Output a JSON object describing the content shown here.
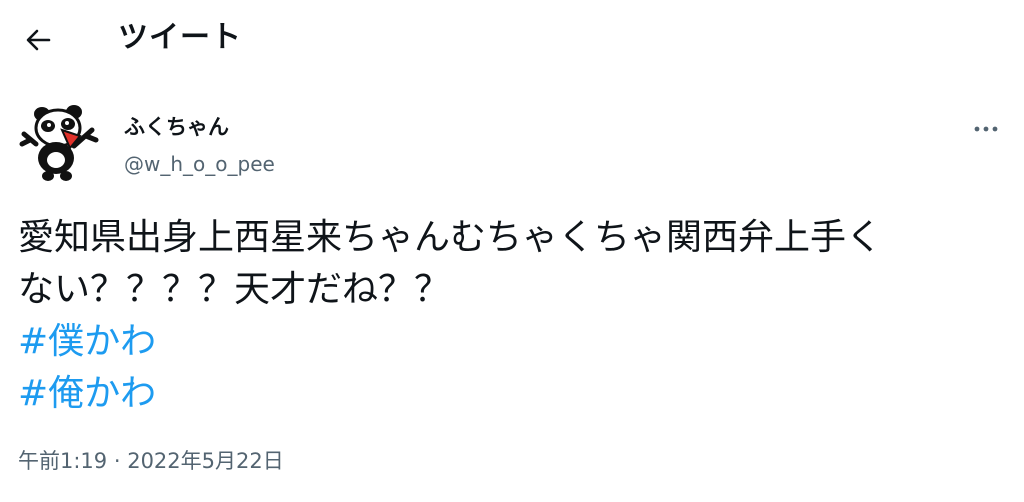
{
  "header": {
    "title": "ツイート",
    "back_icon": "arrow-left-icon"
  },
  "author": {
    "display_name": "ふくちゃん",
    "handle": "@w_h_o_o_pee",
    "avatar": "panda-mascot-avatar",
    "more_icon": "more-horizontal-icon"
  },
  "tweet": {
    "lines": [
      "愛知県出身上西星来ちゃんむちゃくちゃ関西弁上手く",
      "ない？？？？天才だね？？"
    ],
    "hashtags": [
      "#僕かわ",
      "#俺かわ"
    ]
  },
  "meta": {
    "time": "午前1:19",
    "separator": " · ",
    "date": "2022年5月22日"
  },
  "colors": {
    "text": "#0f1419",
    "secondary": "#536471",
    "link": "#1d9bf0"
  }
}
